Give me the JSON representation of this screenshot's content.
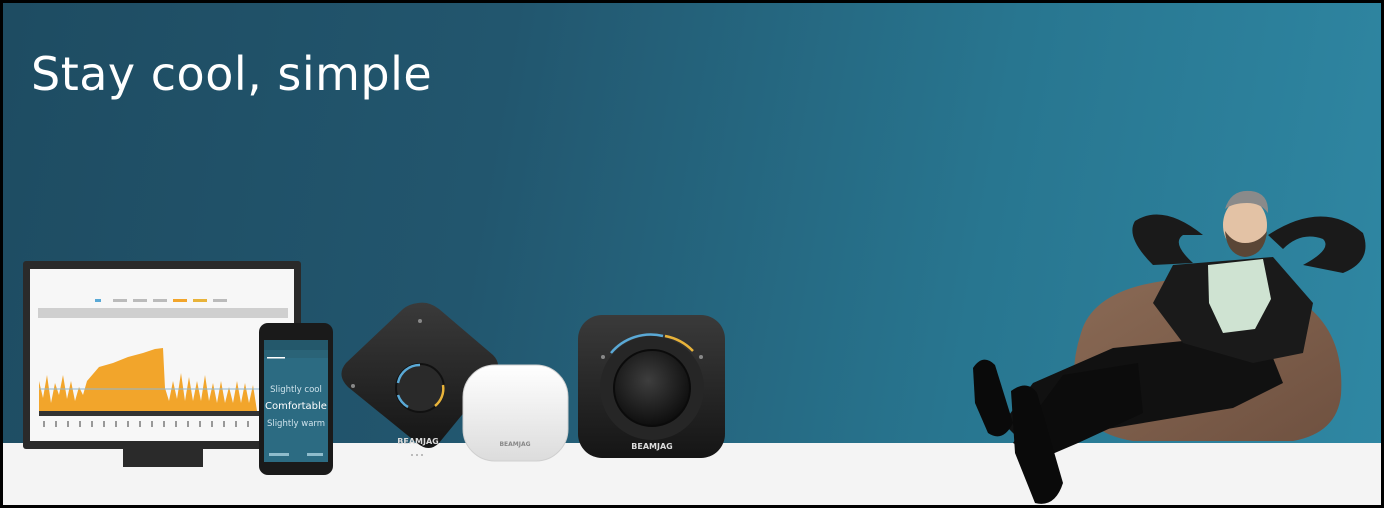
{
  "banner": {
    "headline": "Stay cool, simple"
  },
  "phone": {
    "status_top": "Slightly cool",
    "status_main": "Comfortable",
    "status_bottom": "Slightly warm"
  },
  "devices": {
    "brand_logo": "BEAMJAG"
  },
  "colors": {
    "background_dark": "#1e4c62",
    "background_light": "#2f87a3",
    "chart_fill": "#f2a52b",
    "dial_blue": "#5aa9d6",
    "dial_amber": "#e8b33a"
  }
}
